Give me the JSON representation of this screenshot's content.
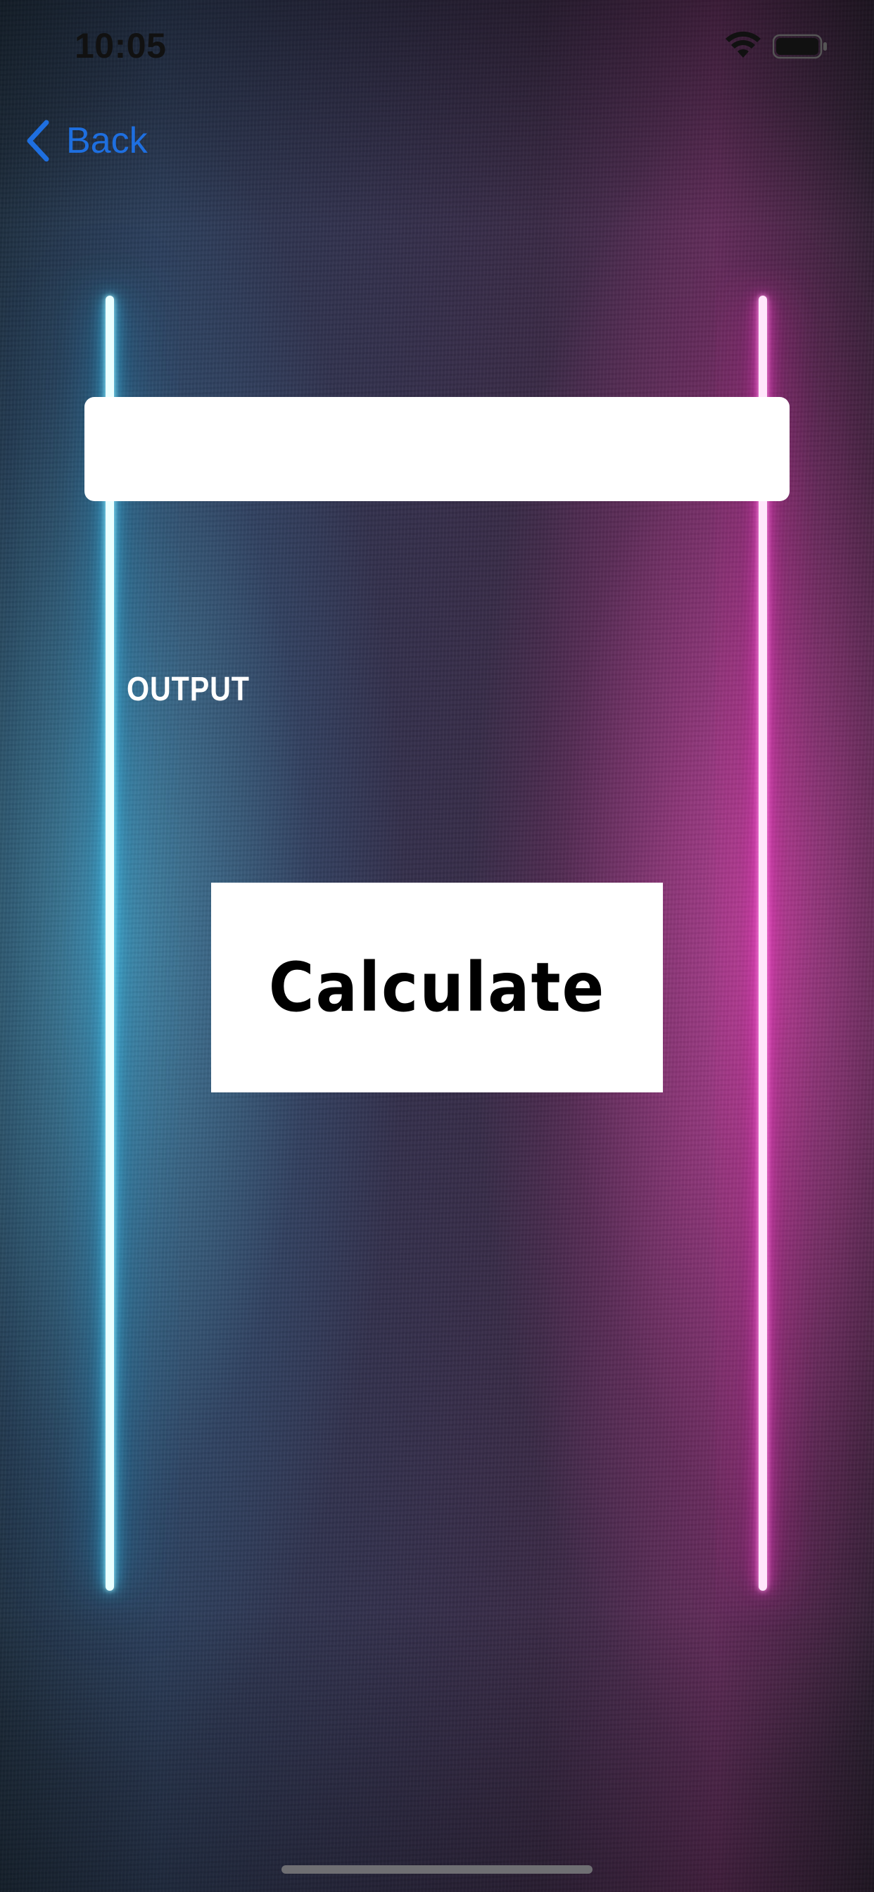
{
  "status_bar": {
    "time": "10:05",
    "wifi_icon": "wifi-icon",
    "battery_icon": "battery-icon"
  },
  "nav": {
    "back_label": "Back",
    "back_icon": "chevron-left-icon",
    "accent_color": "#1e6fe0"
  },
  "input": {
    "value": "",
    "placeholder": ""
  },
  "output": {
    "label": "OUTPUT"
  },
  "calculate": {
    "label": "Calculate"
  },
  "theme": {
    "neon_left_color": "#3fd0ff",
    "neon_right_color": "#ff3fd1",
    "background_color": "#2a2438"
  }
}
